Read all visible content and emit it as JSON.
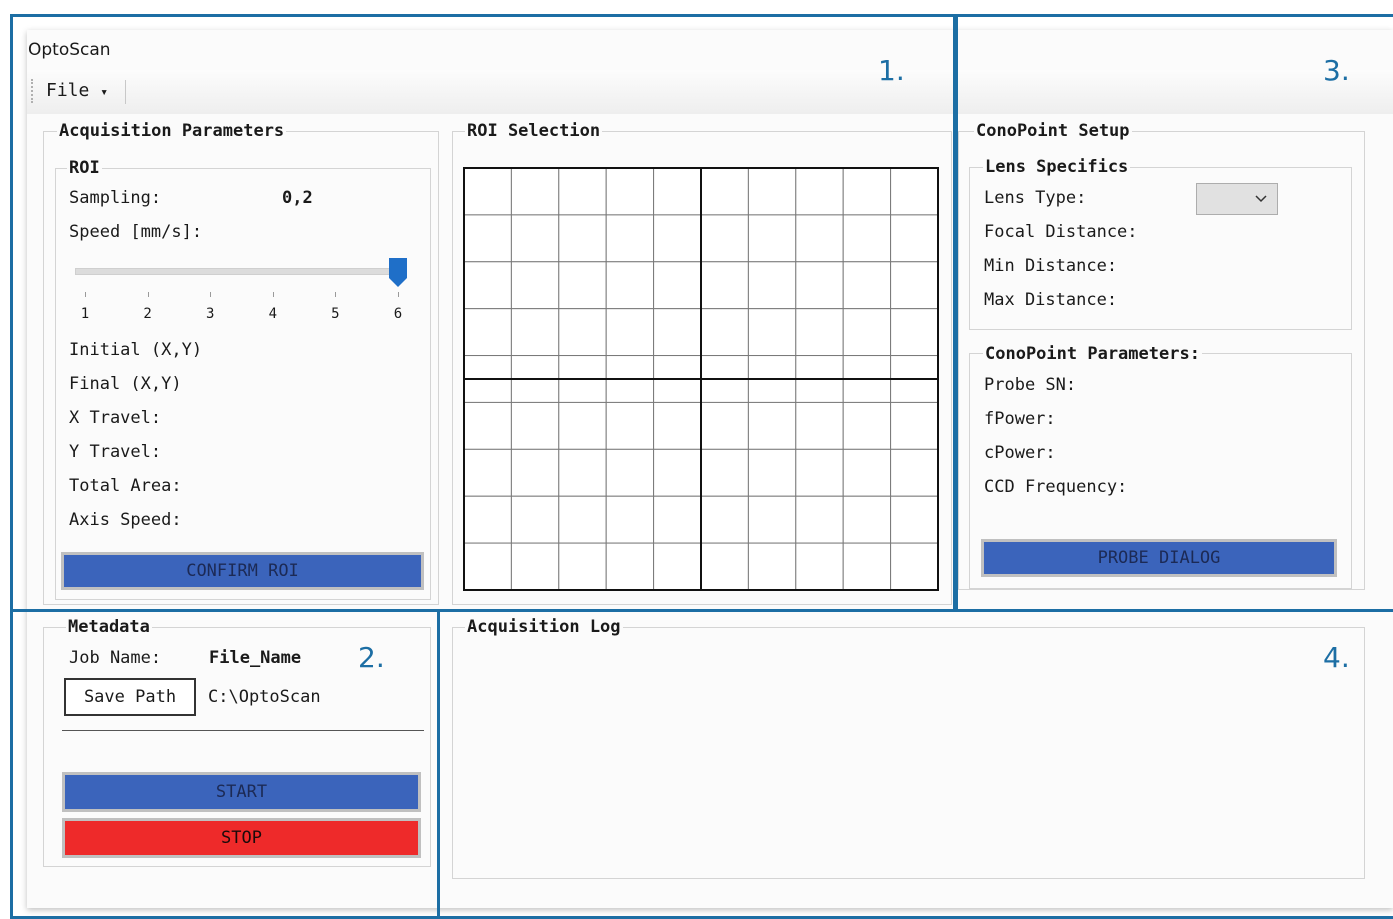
{
  "window": {
    "title": "OptoScan"
  },
  "menu": {
    "file_label": "File",
    "file_arrow": "▾"
  },
  "acquisition": {
    "title": "Acquisition Parameters",
    "roi": {
      "title": "ROI",
      "sampling_label": "Sampling:",
      "sampling_value": "0,2",
      "speed_label": "Speed [mm/s]:",
      "slider_ticks": [
        "1",
        "2",
        "3",
        "4",
        "5",
        "6"
      ],
      "slider_value": 6,
      "fields": [
        "Initial (X,Y)",
        "Final (X,Y)",
        "X Travel:",
        "Y Travel:",
        "Total Area:",
        "Axis Speed:"
      ],
      "confirm_label": "CONFIRM ROI"
    }
  },
  "roi_selection": {
    "title": "ROI Selection",
    "grid_cols": 10,
    "grid_rows": 9
  },
  "conopoint": {
    "title": "ConoPoint Setup",
    "lens": {
      "title": "Lens Specifics",
      "lens_type_label": "Lens Type:",
      "lens_type_value": "",
      "focal_label": "Focal Distance:",
      "min_label": "Min Distance:",
      "max_label": "Max Distance:"
    },
    "params": {
      "title": "ConoPoint Parameters:",
      "probe_sn_label": "Probe SN:",
      "fpower_label": "fPower:",
      "cpower_label": "cPower:",
      "ccd_label": "CCD Frequency:",
      "probe_dialog_label": "PROBE DIALOG"
    }
  },
  "metadata": {
    "title": "Metadata",
    "job_label": "Job Name:",
    "job_value": "File_Name",
    "save_path_label": "Save Path",
    "save_path_value": "C:\\OptoScan",
    "start_label": "START",
    "stop_label": "STOP"
  },
  "log": {
    "title": "Acquisition Log"
  },
  "regions": {
    "r1": "1.",
    "r2": "2.",
    "r3": "3.",
    "r4": "4."
  },
  "colors": {
    "region_border": "#1c6ea4",
    "button_blue": "#3b64bb",
    "button_red": "#ee2a2a"
  }
}
